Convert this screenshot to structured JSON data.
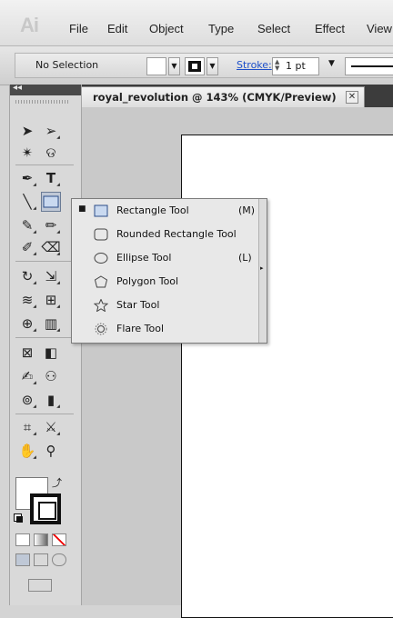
{
  "app": {
    "logo": "Ai"
  },
  "menu": [
    "File",
    "Edit",
    "Object",
    "Type",
    "Select",
    "Effect",
    "View"
  ],
  "control_bar": {
    "selection": "No Selection",
    "stroke_label": "Stroke:",
    "stroke_value": "1 pt"
  },
  "document": {
    "title": "royal_revolution @ 143% (CMYK/Preview)",
    "close_glyph": "✕"
  },
  "tools_panel": {
    "collapse_glyph": "◂◂",
    "tools": [
      {
        "name": "selection-tool",
        "glyph": "➤"
      },
      {
        "name": "direct-selection-tool",
        "glyph": "➢"
      },
      {
        "name": "magic-wand-tool",
        "glyph": "✴"
      },
      {
        "name": "lasso-tool",
        "glyph": "ଡ"
      },
      {
        "name": "pen-tool",
        "glyph": "✒"
      },
      {
        "name": "type-tool",
        "glyph": "T"
      },
      {
        "name": "line-segment-tool",
        "glyph": "╲"
      },
      {
        "name": "rectangle-tool",
        "glyph": "▭"
      }
    ]
  },
  "flyout": {
    "items": [
      {
        "label": "Rectangle Tool",
        "shortcut": "(M)",
        "selected": true,
        "icon": "rectangle-icon"
      },
      {
        "label": "Rounded Rectangle Tool",
        "shortcut": "",
        "selected": false,
        "icon": "rounded-rectangle-icon"
      },
      {
        "label": "Ellipse Tool",
        "shortcut": "(L)",
        "selected": false,
        "icon": "ellipse-icon"
      },
      {
        "label": "Polygon Tool",
        "shortcut": "",
        "selected": false,
        "icon": "polygon-icon"
      },
      {
        "label": "Star Tool",
        "shortcut": "",
        "selected": false,
        "icon": "star-icon"
      },
      {
        "label": "Flare Tool",
        "shortcut": "",
        "selected": false,
        "icon": "flare-icon"
      }
    ],
    "check_glyph": "■"
  },
  "colors": {
    "accent": "#1d4fc9",
    "tab_bar": "#3c3c3c",
    "tool_active": "#bfc8d6"
  }
}
